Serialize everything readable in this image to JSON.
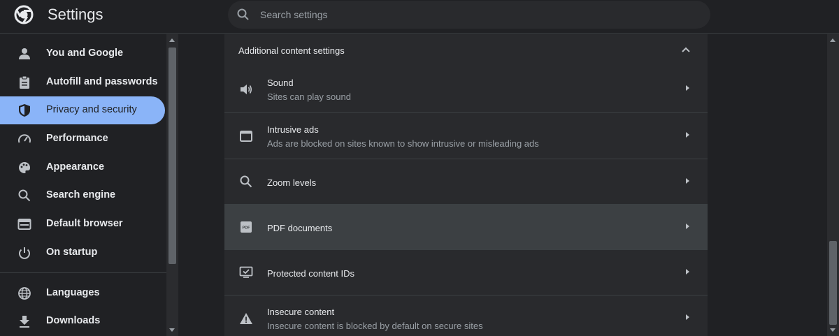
{
  "header": {
    "app_title": "Settings",
    "search_placeholder": "Search settings",
    "logo_icon": "chrome-logo-icon"
  },
  "sidebar": {
    "items": [
      {
        "label": "You and Google",
        "icon": "person-icon"
      },
      {
        "label": "Autofill and passwords",
        "icon": "clipboard-icon"
      },
      {
        "label": "Privacy and security",
        "icon": "shield-icon",
        "active": true
      },
      {
        "label": "Performance",
        "icon": "speedometer-icon"
      },
      {
        "label": "Appearance",
        "icon": "palette-icon"
      },
      {
        "label": "Search engine",
        "icon": "search-icon"
      },
      {
        "label": "Default browser",
        "icon": "browser-icon"
      },
      {
        "label": "On startup",
        "icon": "power-icon"
      },
      {
        "label": "Languages",
        "icon": "globe-icon"
      },
      {
        "label": "Downloads",
        "icon": "download-icon"
      }
    ]
  },
  "main": {
    "section_title": "Additional content settings",
    "rows": [
      {
        "title": "Sound",
        "subtitle": "Sites can play sound",
        "icon": "speaker-icon"
      },
      {
        "title": "Intrusive ads",
        "subtitle": "Ads are blocked on sites known to show intrusive or misleading ads",
        "icon": "window-icon"
      },
      {
        "title": "Zoom levels",
        "subtitle": "",
        "icon": "magnifier-icon"
      },
      {
        "title": "PDF documents",
        "subtitle": "",
        "icon": "pdf-icon",
        "hovered": true
      },
      {
        "title": "Protected content IDs",
        "subtitle": "",
        "icon": "monitor-check-icon"
      },
      {
        "title": "Insecure content",
        "subtitle": "Insecure content is blocked by default on secure sites",
        "icon": "warning-icon"
      }
    ]
  },
  "colors": {
    "background": "#202124",
    "panel": "#292a2d",
    "active_accent": "#8ab4f8",
    "row_hover": "#3c4043"
  }
}
